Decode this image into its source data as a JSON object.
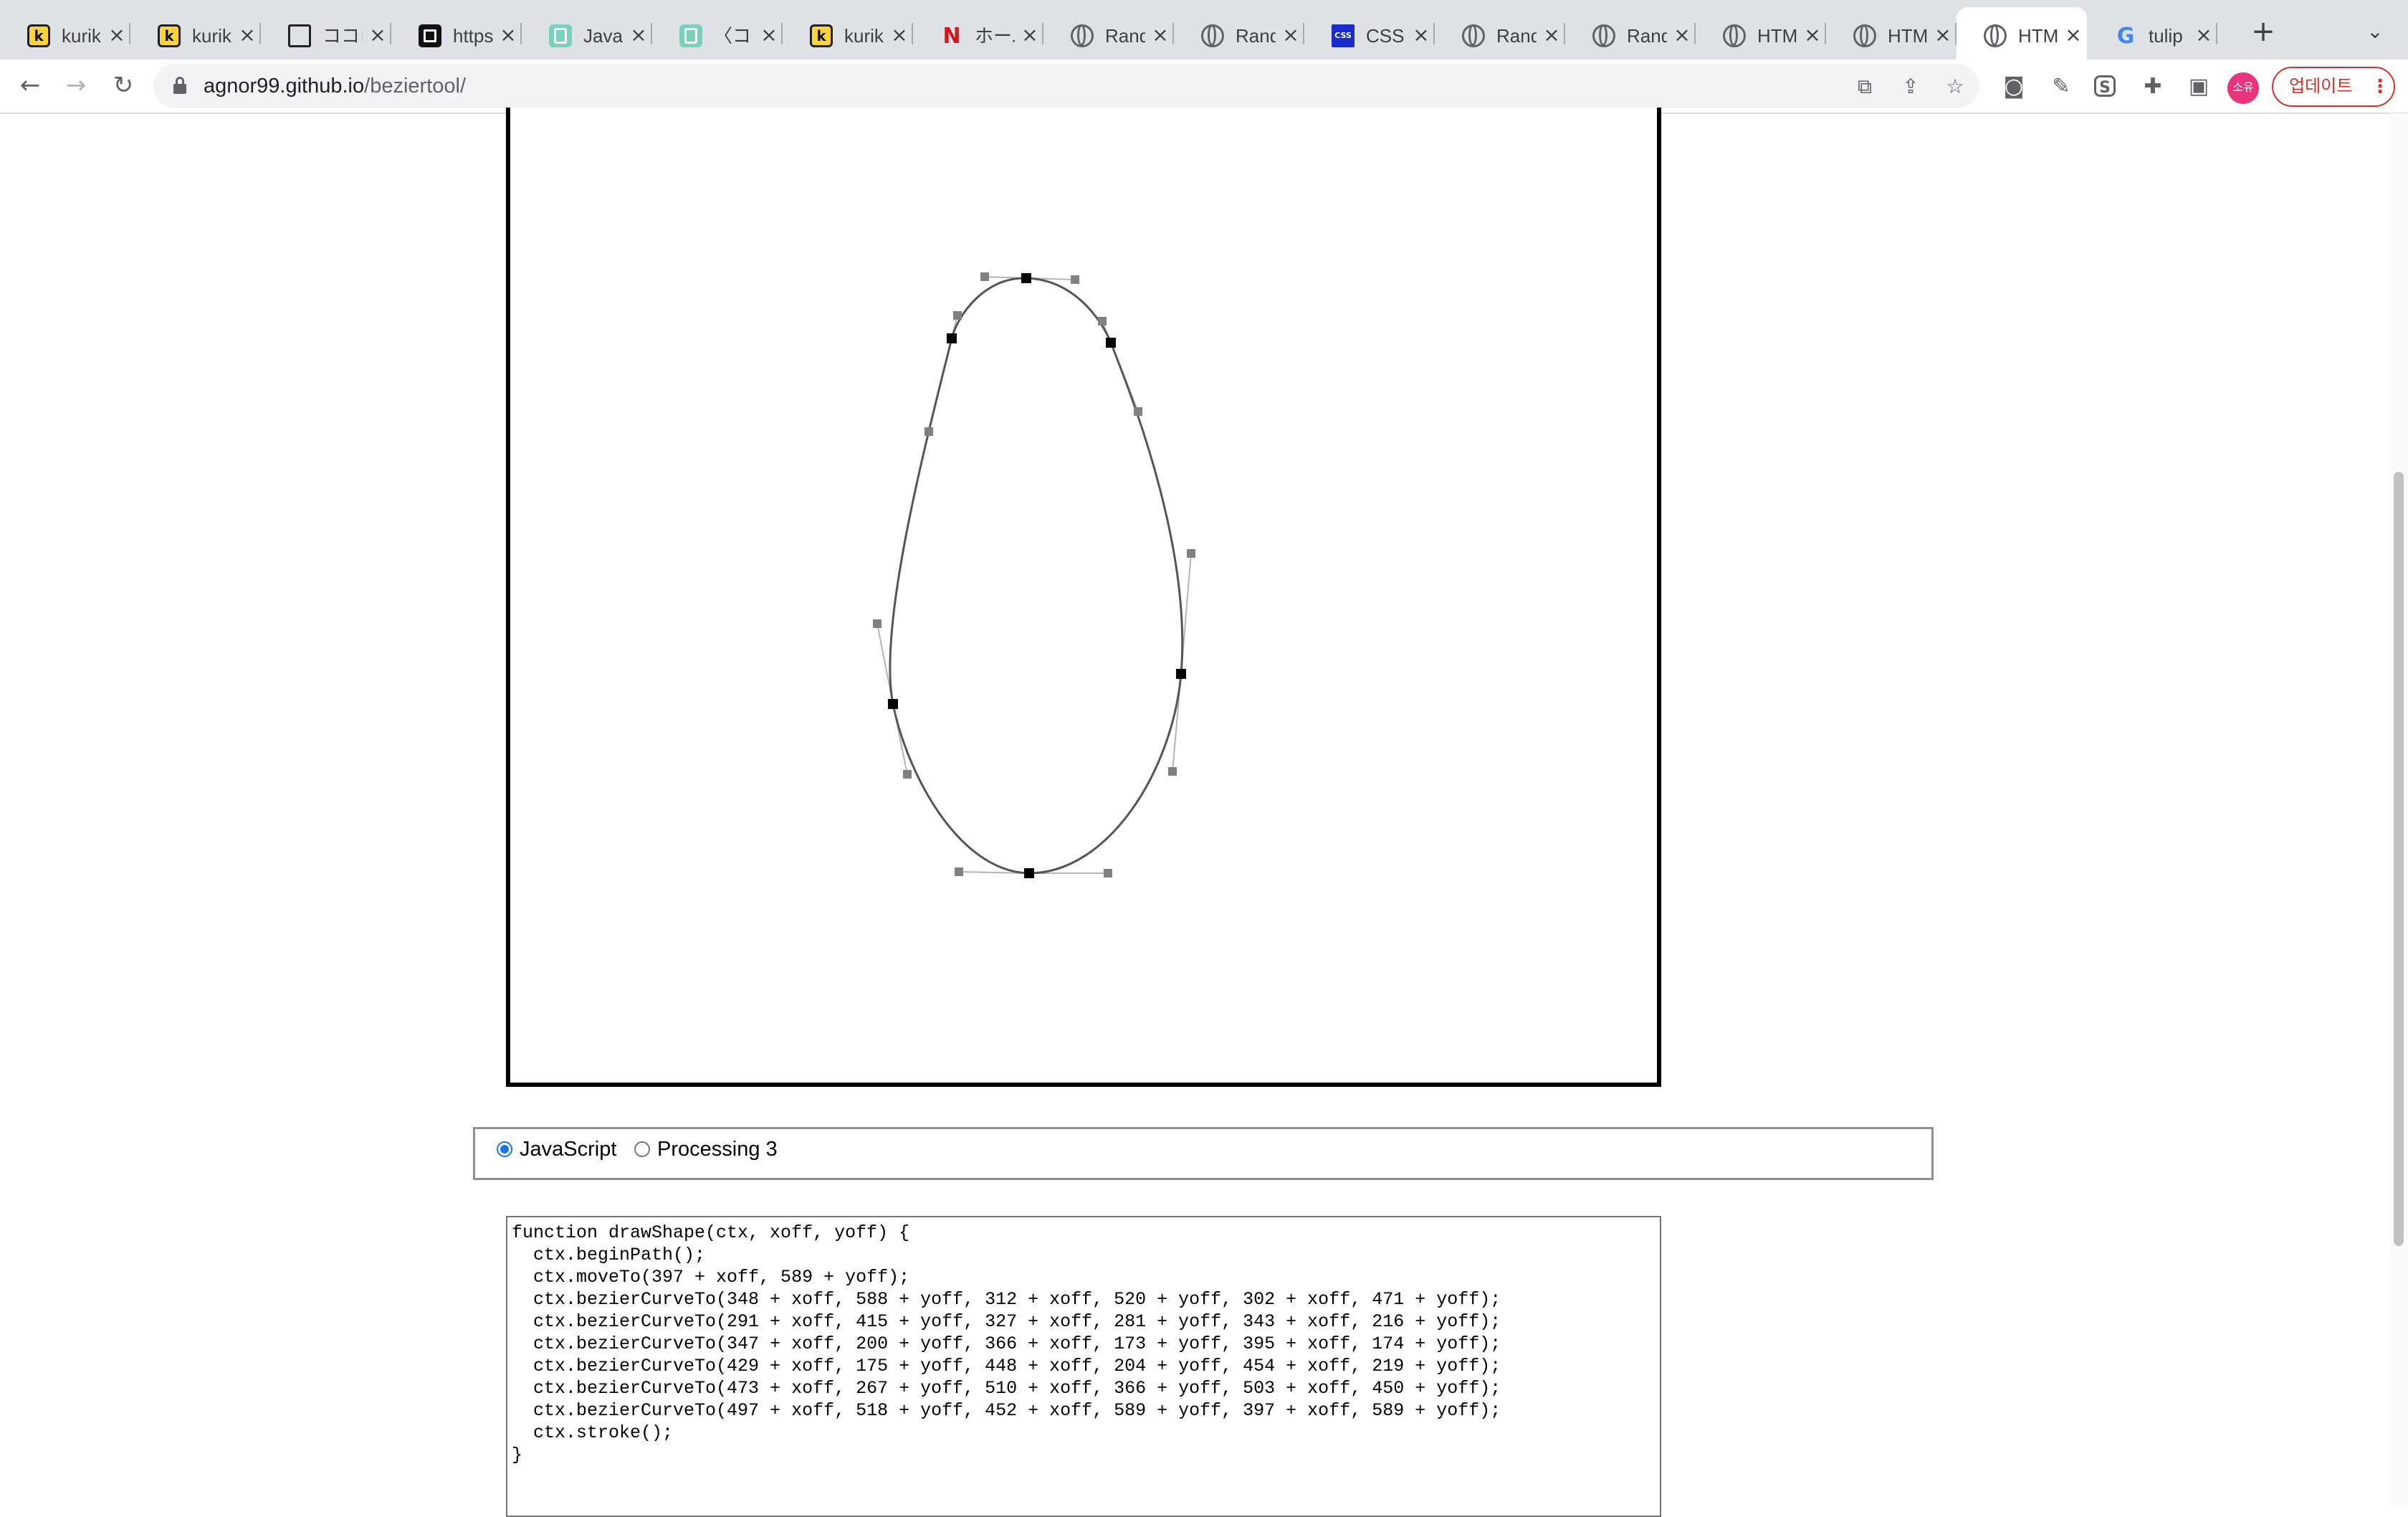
{
  "tabs": [
    {
      "title": "kurik",
      "favicon": "k-logo-icon"
    },
    {
      "title": "kurik",
      "favicon": "k-logo-icon"
    },
    {
      "title": "ココロ",
      "favicon": "square-outline-icon"
    },
    {
      "title": "https",
      "favicon": "black-square-icon"
    },
    {
      "title": "Java",
      "favicon": "teal-doc-icon"
    },
    {
      "title": "〈ココ",
      "favicon": "teal-doc-icon"
    },
    {
      "title": "kurik",
      "favicon": "k-logo-icon"
    },
    {
      "title": "ホーム",
      "favicon": "netflix-n-icon"
    },
    {
      "title": "Rand",
      "favicon": "globe-icon"
    },
    {
      "title": "Rand",
      "favicon": "globe-icon"
    },
    {
      "title": "CSS",
      "favicon": "css-logo-icon"
    },
    {
      "title": "Rand",
      "favicon": "globe-icon"
    },
    {
      "title": "Rand",
      "favicon": "globe-icon"
    },
    {
      "title": "HTM",
      "favicon": "globe-icon"
    },
    {
      "title": "HTM",
      "favicon": "globe-icon"
    },
    {
      "title": "HTM",
      "favicon": "globe-icon",
      "active": true
    },
    {
      "title": "tulip",
      "favicon": "google-g-icon"
    }
  ],
  "toolbar": {
    "url_domain": "agnor99.github.io",
    "url_path": "/beziertool/",
    "profile_initials": "소유",
    "update_label": "업데이트"
  },
  "language_options": [
    {
      "label": "JavaScript",
      "checked": true
    },
    {
      "label": "Processing 3",
      "checked": false
    }
  ],
  "code": "function drawShape(ctx, xoff, yoff) {\n  ctx.beginPath();\n  ctx.moveTo(397 + xoff, 589 + yoff);\n  ctx.bezierCurveTo(348 + xoff, 588 + yoff, 312 + xoff, 520 + yoff, 302 + xoff, 471 + yoff);\n  ctx.bezierCurveTo(291 + xoff, 415 + yoff, 327 + xoff, 281 + yoff, 343 + xoff, 216 + yoff);\n  ctx.bezierCurveTo(347 + xoff, 200 + yoff, 366 + xoff, 173 + yoff, 395 + xoff, 174 + yoff);\n  ctx.bezierCurveTo(429 + xoff, 175 + yoff, 448 + xoff, 204 + yoff, 454 + xoff, 219 + yoff);\n  ctx.bezierCurveTo(473 + xoff, 267 + yoff, 510 + xoff, 366 + yoff, 503 + xoff, 450 + yoff);\n  ctx.bezierCurveTo(497 + xoff, 518 + yoff, 452 + xoff, 589 + yoff, 397 + xoff, 589 + yoff);\n  ctx.stroke();\n}",
  "bezier_shape": {
    "start": [
      397,
      589
    ],
    "segments": [
      [
        348,
        588,
        312,
        520,
        302,
        471
      ],
      [
        291,
        415,
        327,
        281,
        343,
        216
      ],
      [
        347,
        200,
        366,
        173,
        395,
        174
      ],
      [
        429,
        175,
        448,
        204,
        454,
        219
      ],
      [
        473,
        267,
        510,
        366,
        503,
        450
      ],
      [
        497,
        518,
        452,
        589,
        397,
        589
      ]
    ],
    "curve_color": "#555555",
    "anchor_color": "#000000",
    "handle_color": "#808080"
  },
  "colors": {
    "tabstrip_bg": "#dee1e6",
    "update_accent": "#d93025",
    "profile_bg": "#e8337d",
    "radio_accent": "#1a73e8"
  }
}
